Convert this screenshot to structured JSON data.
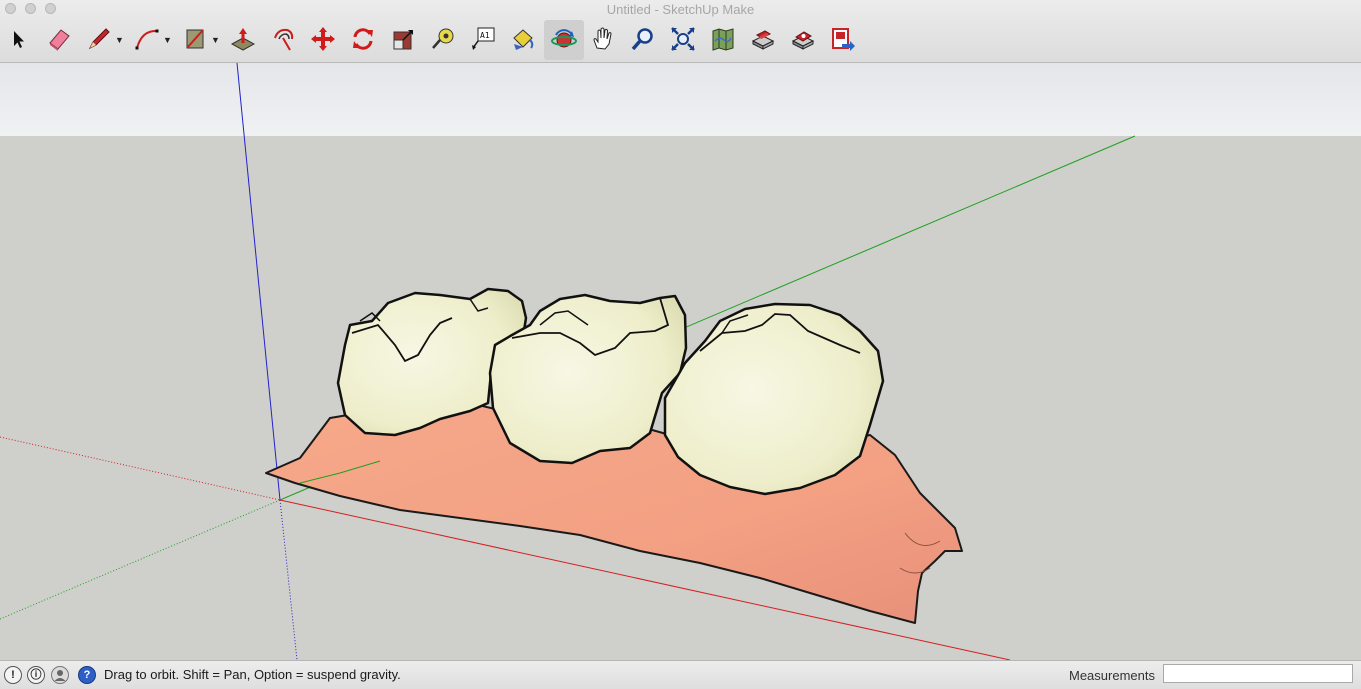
{
  "window": {
    "title": "Untitled - SketchUp Make"
  },
  "toolbar": {
    "tools": [
      {
        "name": "select-tool",
        "icon": "arrow-cursor-icon"
      },
      {
        "name": "eraser-tool",
        "icon": "eraser-icon"
      },
      {
        "name": "line-tool",
        "icon": "pencil-icon"
      },
      {
        "name": "arc-tool",
        "icon": "arc-icon"
      },
      {
        "name": "rectangle-tool",
        "icon": "rectangle-icon"
      },
      {
        "name": "push-pull-tool",
        "icon": "push-pull-icon"
      },
      {
        "name": "offset-tool",
        "icon": "offset-icon"
      },
      {
        "name": "move-tool",
        "icon": "move-arrows-icon"
      },
      {
        "name": "rotate-tool",
        "icon": "rotate-icon"
      },
      {
        "name": "scale-tool",
        "icon": "scale-icon"
      },
      {
        "name": "tape-measure-tool",
        "icon": "tape-measure-icon"
      },
      {
        "name": "text-tool",
        "icon": "text-label-icon"
      },
      {
        "name": "paint-bucket-tool",
        "icon": "paint-bucket-icon"
      },
      {
        "name": "orbit-tool",
        "icon": "orbit-icon"
      },
      {
        "name": "pan-tool",
        "icon": "hand-icon"
      },
      {
        "name": "zoom-tool",
        "icon": "magnifier-icon"
      },
      {
        "name": "zoom-extents-tool",
        "icon": "zoom-extents-icon"
      },
      {
        "name": "add-location-tool",
        "icon": "map-icon"
      },
      {
        "name": "3d-warehouse-tool",
        "icon": "warehouse-icon"
      },
      {
        "name": "extension-warehouse-tool",
        "icon": "extension-icon"
      },
      {
        "name": "send-to-layout-tool",
        "icon": "layout-icon"
      }
    ],
    "text_tool_glyph": "A1",
    "active_tool": "orbit-tool"
  },
  "status": {
    "message": "Drag to orbit. Shift = Pan, Option = suspend gravity.",
    "help_glyph": "?"
  },
  "measurements": {
    "label": "Measurements",
    "value": ""
  },
  "colors": {
    "x_axis": "#d22020",
    "y_axis": "#1fa01f",
    "z_axis": "#2222cc",
    "gum": "#f7a988",
    "tooth": "#f0f0d2",
    "sky": "#e9ebee",
    "ground": "#cfcfcc"
  }
}
